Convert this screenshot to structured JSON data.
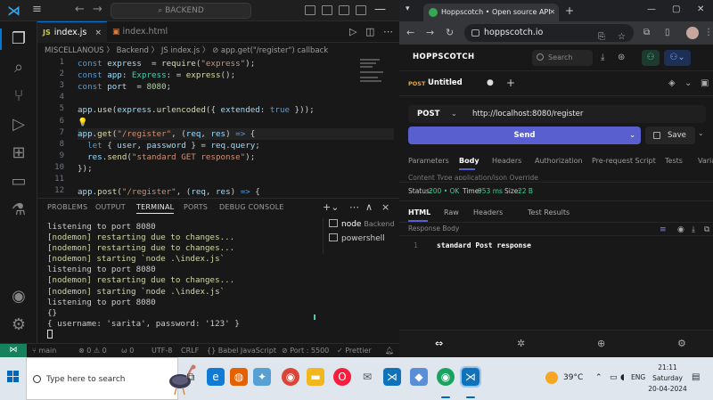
{
  "vscode": {
    "command_center": "BACKEND",
    "tabs": [
      {
        "label": "index.js",
        "close": "×"
      },
      {
        "label": "index.html"
      }
    ],
    "breadcrumb": "MISCELLANOUS 〉 Backend 〉 JS index.js 〉 ⊘ app.get(\"/register\") callback",
    "code_lines": [
      {
        "n": "1",
        "parts": [
          [
            "kw",
            "const "
          ],
          [
            "var",
            "express"
          ],
          [
            "",
            "  = "
          ],
          [
            "fn",
            "require"
          ],
          [
            "",
            "("
          ],
          [
            "str",
            "\"express\""
          ],
          [
            "",
            ");"
          ]
        ]
      },
      {
        "n": "2",
        "parts": [
          [
            "kw",
            "const "
          ],
          [
            "var",
            "app"
          ],
          [
            "",
            ": "
          ],
          [
            "typ",
            "Express"
          ],
          [
            "",
            ": = "
          ],
          [
            "fn",
            "express"
          ],
          [
            "",
            "();"
          ]
        ]
      },
      {
        "n": "3",
        "parts": [
          [
            "kw",
            "const "
          ],
          [
            "var",
            "port"
          ],
          [
            "",
            "  = "
          ],
          [
            "num",
            "8080"
          ],
          [
            "",
            ";"
          ]
        ]
      },
      {
        "n": "4",
        "parts": []
      },
      {
        "n": "5",
        "parts": [
          [
            "var",
            "app"
          ],
          [
            "",
            "."
          ],
          [
            "fn",
            "use"
          ],
          [
            "",
            "("
          ],
          [
            "var",
            "express"
          ],
          [
            "",
            "."
          ],
          [
            "fn",
            "urlencoded"
          ],
          [
            "",
            "({ "
          ],
          [
            "var",
            "extended"
          ],
          [
            "",
            ": "
          ],
          [
            "kw",
            "true"
          ],
          [
            "",
            " }));"
          ]
        ]
      },
      {
        "n": "6",
        "parts": [
          [
            "bul",
            "💡"
          ]
        ]
      },
      {
        "n": "7",
        "parts": [
          [
            "var",
            "app"
          ],
          [
            "",
            "."
          ],
          [
            "fn",
            "get"
          ],
          [
            "",
            "("
          ],
          [
            "str",
            "\"/register\""
          ],
          [
            "",
            ", ("
          ],
          [
            "var",
            "req"
          ],
          [
            "",
            ", "
          ],
          [
            "var",
            "res"
          ],
          [
            "",
            ") "
          ],
          [
            "kw",
            "=>"
          ],
          [
            "",
            " {"
          ]
        ]
      },
      {
        "n": "8",
        "parts": [
          [
            "",
            "  "
          ],
          [
            "kw",
            "let"
          ],
          [
            "",
            " { "
          ],
          [
            "var",
            "user"
          ],
          [
            "",
            ", "
          ],
          [
            "var",
            "password"
          ],
          [
            "",
            " } = "
          ],
          [
            "var",
            "req"
          ],
          [
            "",
            "."
          ],
          [
            "var",
            "query"
          ],
          [
            "",
            ";"
          ]
        ]
      },
      {
        "n": "9",
        "parts": [
          [
            "",
            "  "
          ],
          [
            "var",
            "res"
          ],
          [
            "",
            "."
          ],
          [
            "fn",
            "send"
          ],
          [
            "",
            "("
          ],
          [
            "str",
            "\"standard GET response\""
          ],
          [
            "",
            ");"
          ]
        ]
      },
      {
        "n": "10",
        "parts": [
          [
            "",
            "});"
          ]
        ]
      },
      {
        "n": "11",
        "parts": []
      },
      {
        "n": "12",
        "parts": [
          [
            "var",
            "app"
          ],
          [
            "",
            "."
          ],
          [
            "fn",
            "post"
          ],
          [
            "",
            "("
          ],
          [
            "str",
            "\"/register\""
          ],
          [
            "",
            ", ("
          ],
          [
            "var",
            "req"
          ],
          [
            "",
            ", "
          ],
          [
            "var",
            "res"
          ],
          [
            "",
            ") "
          ],
          [
            "kw",
            "=>"
          ],
          [
            "",
            " {"
          ]
        ]
      }
    ],
    "panel_tabs": [
      "PROBLEMS",
      "OUTPUT",
      "TERMINAL",
      "PORTS",
      "DEBUG CONSOLE"
    ],
    "terminal": [
      {
        "text": "listening to port 8080",
        "c": ""
      },
      {
        "text": "[nodemon] restarting due to changes...",
        "c": "g"
      },
      {
        "text": "[nodemon] restarting due to changes...",
        "c": "g"
      },
      {
        "text": "[nodemon] starting `node .\\index.js`",
        "c": "g"
      },
      {
        "text": "listening to port 8080",
        "c": ""
      },
      {
        "text": "[nodemon] restarting due to changes...",
        "c": "g"
      },
      {
        "text": "[nodemon] starting `node .\\index.js`",
        "c": "g"
      },
      {
        "text": "listening to port 8080",
        "c": ""
      },
      {
        "text": "{}",
        "c": ""
      },
      {
        "text": "{ username: 'sarita', password: '123' }",
        "c": ""
      }
    ],
    "terminal_list": [
      {
        "label": "node",
        "sub": "Backend"
      },
      {
        "label": "powershell",
        "sub": ""
      }
    ],
    "status": {
      "branch": "main",
      "errors": "⊗ 0 ⚠ 0",
      "ports": "ω 0",
      "encoding": "UTF-8",
      "eol": "CRLF",
      "lang": "{} Babel JavaScript",
      "port": "⊘ Port : 5500",
      "prettier": "✓ Prettier"
    }
  },
  "browser": {
    "tab_title": "Hoppscotch • Open source API",
    "url": "hoppscotch.io",
    "app": {
      "logo": "HOPPSCOTCH",
      "search_placeholder": "Search",
      "request_method_tag": "POST",
      "request_name": "Untitled",
      "method": "POST",
      "request_url": "http://localhost:8080/register",
      "send_label": "Send",
      "save_label": "Save",
      "subtabs": [
        "Parameters",
        "Body",
        "Headers",
        "Authorization",
        "Pre-request Script",
        "Tests",
        "Varia"
      ],
      "content_type": "Content Type     application/json          Override",
      "status": {
        "code_label": "Status:",
        "code": "200 • OK",
        "time_label": "Time:",
        "time": "953 ms",
        "size_label": "Size:",
        "size": "22 B"
      },
      "resp_tabs": [
        "HTML",
        "Raw",
        "Headers",
        "Test Results"
      ],
      "body_label": "Response Body",
      "resp_line": "1",
      "resp_text": "standard Post response"
    }
  },
  "taskbar": {
    "search_placeholder": "Type here to search",
    "weather": "39°C",
    "lang": "ENG",
    "time": "21:11",
    "day": "Saturday",
    "date": "20-04-2024"
  }
}
